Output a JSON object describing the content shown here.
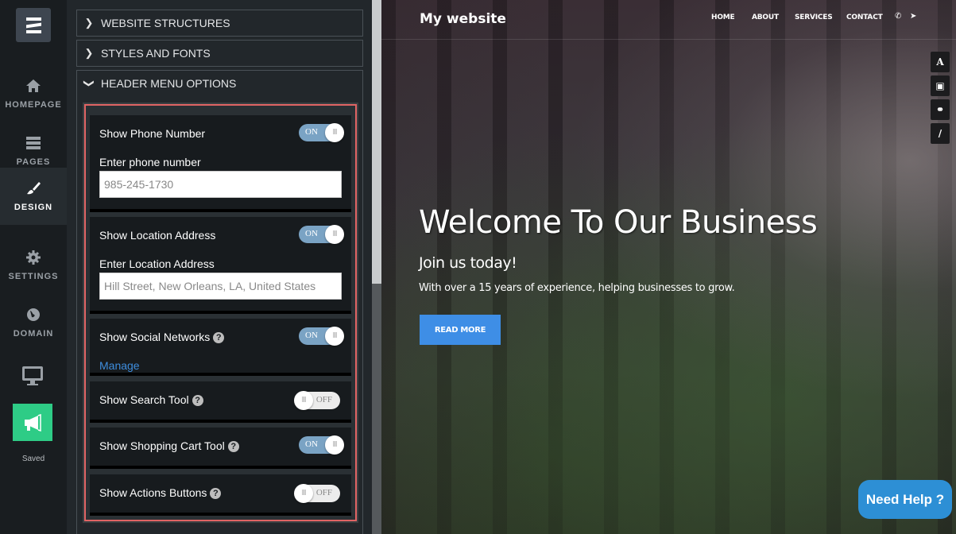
{
  "sidebar": {
    "menu_icon": "hamburger-icon",
    "items": [
      {
        "label": "HOMEPAGE",
        "icon": "home-icon",
        "active": false
      },
      {
        "label": "PAGES",
        "icon": "pages-icon",
        "active": false
      },
      {
        "label": "DESIGN",
        "icon": "brush-icon",
        "active": true
      },
      {
        "label": "SETTINGS",
        "icon": "gear-icon",
        "active": false
      },
      {
        "label": "DOMAIN",
        "icon": "globe-icon",
        "active": false
      }
    ],
    "preview_icon": "monitor-icon",
    "publish_icon": "megaphone-icon",
    "status": "Saved",
    "publish_color": "#2ecc86"
  },
  "panel": {
    "sections": [
      {
        "label": "WEBSITE STRUCTURES",
        "expanded": false
      },
      {
        "label": "STYLES AND FONTS",
        "expanded": false
      },
      {
        "label": "HEADER MENU OPTIONS",
        "expanded": true
      }
    ],
    "options": [
      {
        "title": "Show Phone Number",
        "state": "ON",
        "field_label": "Enter phone number",
        "field_value": "985-245-1730"
      },
      {
        "title": "Show Location Address",
        "state": "ON",
        "field_label": "Enter Location Address",
        "field_value": "Hill Street, New Orleans, LA, United States"
      },
      {
        "title": "Show Social Networks",
        "state": "ON",
        "help": "?",
        "link": "Manage"
      },
      {
        "title": "Show Search Tool",
        "state": "OFF",
        "help": "?"
      },
      {
        "title": "Show Shopping Cart Tool",
        "state": "ON",
        "help": "?"
      },
      {
        "title": "Show Actions Buttons",
        "state": "OFF",
        "help": "?"
      }
    ],
    "toggle_knob": "III",
    "highlight_color": "#e06464"
  },
  "preview": {
    "logo": "My website",
    "nav": [
      "HOME",
      "ABOUT",
      "SERVICES",
      "CONTACT"
    ],
    "nav_icons": [
      "phone-icon",
      "location-arrow-icon"
    ],
    "tools": [
      {
        "icon": "font-icon",
        "glyph": "A"
      },
      {
        "icon": "image-icon",
        "glyph": "▣"
      },
      {
        "icon": "link-icon",
        "glyph": "⚭"
      },
      {
        "icon": "brush-icon",
        "glyph": "/"
      }
    ],
    "hero_title": "Welcome To Our Business",
    "hero_subtitle": "Join us today!",
    "hero_text": "With over a 15 years of experience, helping businesses to grow.",
    "cta": "READ MORE",
    "cta_color": "#3e8ee6"
  },
  "help_button": {
    "label": "Need Help ?",
    "color": "#2d8fd5"
  }
}
